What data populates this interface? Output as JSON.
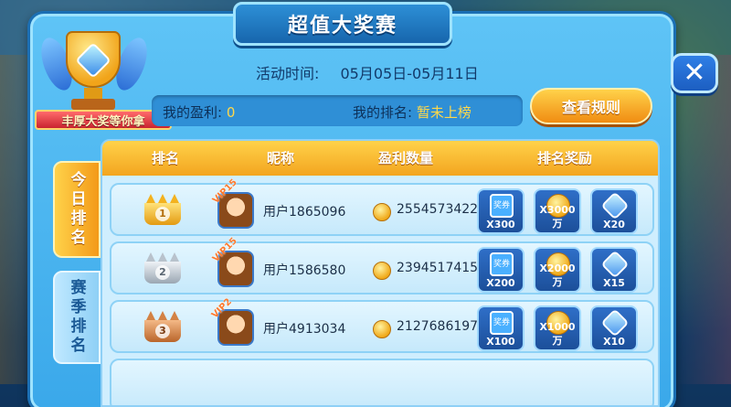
{
  "header": {
    "title": "超值大奖赛"
  },
  "trophy": {
    "ribbon_text": "丰厚大奖等你拿"
  },
  "event": {
    "time_label": "活动时间:",
    "time_value": "05月05日-05月11日"
  },
  "my_stats": {
    "profit_label": "我的盈利:",
    "profit_value": "0",
    "rank_label": "我的排名:",
    "rank_value": "暂未上榜"
  },
  "rules_button": "查看规则",
  "tabs": [
    {
      "label": "今日排名",
      "active": true
    },
    {
      "label": "赛季排名",
      "active": false
    }
  ],
  "table": {
    "headers": [
      "排名",
      "昵称",
      "盈利数量",
      "排名奖励"
    ],
    "rows": [
      {
        "rank": "1",
        "vip": "VIP15",
        "nickname": "用户1865096",
        "profit": "2554573422",
        "rewards": [
          {
            "icon": "ticket-icon",
            "label": "奖券",
            "qty": "X300"
          },
          {
            "icon": "gold-coin-icon",
            "label": "",
            "qty": "X3000万"
          },
          {
            "icon": "gem-icon",
            "label": "",
            "qty": "X20"
          }
        ]
      },
      {
        "rank": "2",
        "vip": "VIP15",
        "nickname": "用户1586580",
        "profit": "2394517415",
        "rewards": [
          {
            "icon": "ticket-icon",
            "label": "奖券",
            "qty": "X200"
          },
          {
            "icon": "gold-coin-icon",
            "label": "",
            "qty": "X2000万"
          },
          {
            "icon": "gem-icon",
            "label": "",
            "qty": "X15"
          }
        ]
      },
      {
        "rank": "3",
        "vip": "VIP2",
        "nickname": "用户4913034",
        "profit": "2127686197",
        "rewards": [
          {
            "icon": "ticket-icon",
            "label": "奖券",
            "qty": "X100"
          },
          {
            "icon": "gold-coin-icon",
            "label": "",
            "qty": "X1000万"
          },
          {
            "icon": "gem-icon",
            "label": "",
            "qty": "X10"
          }
        ]
      }
    ]
  },
  "colors": {
    "gold": "#ffd24a",
    "silver": "#c9d2dc",
    "bronze": "#d88a4a",
    "accent_orange": "#f39a18"
  }
}
